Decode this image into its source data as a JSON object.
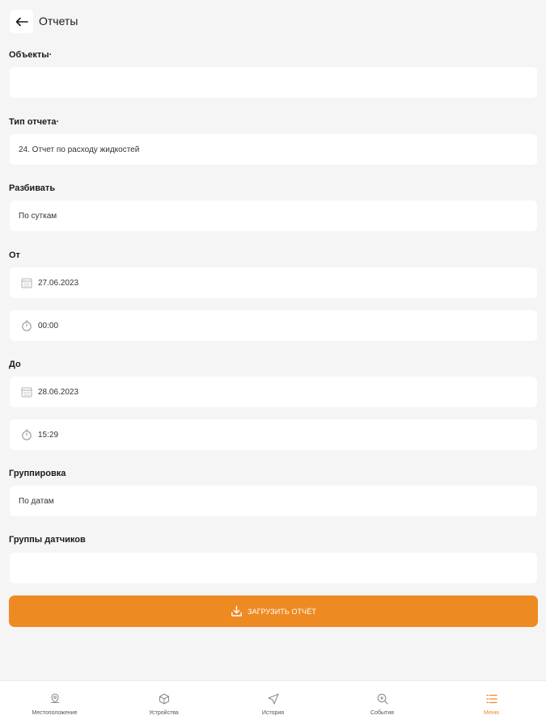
{
  "header": {
    "title": "Отчеты"
  },
  "form": {
    "objects": {
      "label": "Объекты·",
      "value": ""
    },
    "report_type": {
      "label": "Тип отчета·",
      "value": "24. Отчет по расходу жидкостей"
    },
    "split": {
      "label": "Разбивать",
      "value": "По суткам"
    },
    "from": {
      "label": "От",
      "date": "27.06.2023",
      "time": "00:00"
    },
    "to": {
      "label": "До",
      "date": "28.06.2023",
      "time": "15:29"
    },
    "grouping": {
      "label": "Группировка",
      "value": "По датам"
    },
    "sensor_groups": {
      "label": "Группы датчиков",
      "value": ""
    }
  },
  "action": {
    "load_label": "ЗАГРУЗИТЬ ОТЧЁТ"
  },
  "nav": {
    "items": [
      {
        "label": "Местоположение",
        "icon": "location-icon"
      },
      {
        "label": "Устройства",
        "icon": "devices-icon"
      },
      {
        "label": "История",
        "icon": "history-icon"
      },
      {
        "label": "События",
        "icon": "events-icon"
      },
      {
        "label": "Меню",
        "icon": "menu-icon"
      }
    ],
    "active_index": 4
  },
  "colors": {
    "accent": "#ee8a22",
    "background": "#f5f5f5",
    "field": "#ffffff"
  }
}
